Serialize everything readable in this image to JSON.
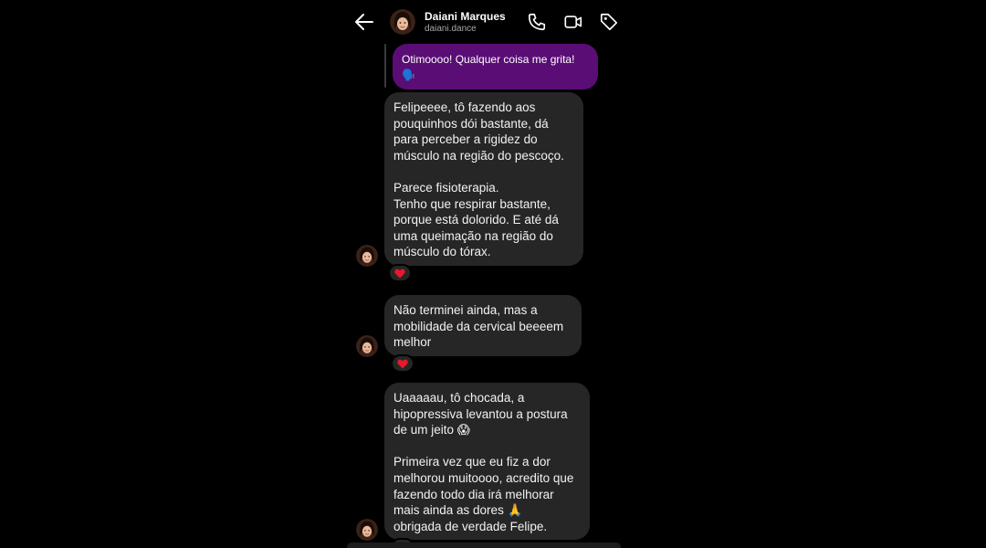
{
  "contact": {
    "name": "Daiani Marques",
    "username": "daiani.dance"
  },
  "icons": {
    "back": "arrow-left-icon",
    "call": "phone-icon",
    "video": "video-camera-icon",
    "tag": "tag-icon",
    "reaction": "heart-icon"
  },
  "colors": {
    "background": "#000000",
    "received_bubble": "#262626",
    "sent_bubble": "#5a0d75",
    "heart": "#e8192c"
  },
  "replied_message": {
    "text": "Otimoooo! Qualquer coisa me grita! 🗣️"
  },
  "messages": [
    {
      "text": "Felipeeee, tô fazendo aos pouquinhos dói bastante, dá para perceber a rigidez do músculo na região do pescoço.\n\nParece fisioterapia.\nTenho que respirar bastante, porque está dolorido. E até dá uma queimação na região do músculo do tórax.",
      "reaction": "❤️"
    },
    {
      "text": "Não terminei ainda, mas a mobilidade da cervical beeeem melhor",
      "reaction": "❤️"
    },
    {
      "text": "Uaaaaau, tô chocada, a hipopressiva levantou a postura de um jeito 😱\n\nPrimeira vez que eu fiz a dor melhorou muitoooo, acredito que fazendo todo dia irá melhorar mais ainda as dores 🙏\nobrigada de verdade Felipe.",
      "reaction": "❤️"
    }
  ]
}
